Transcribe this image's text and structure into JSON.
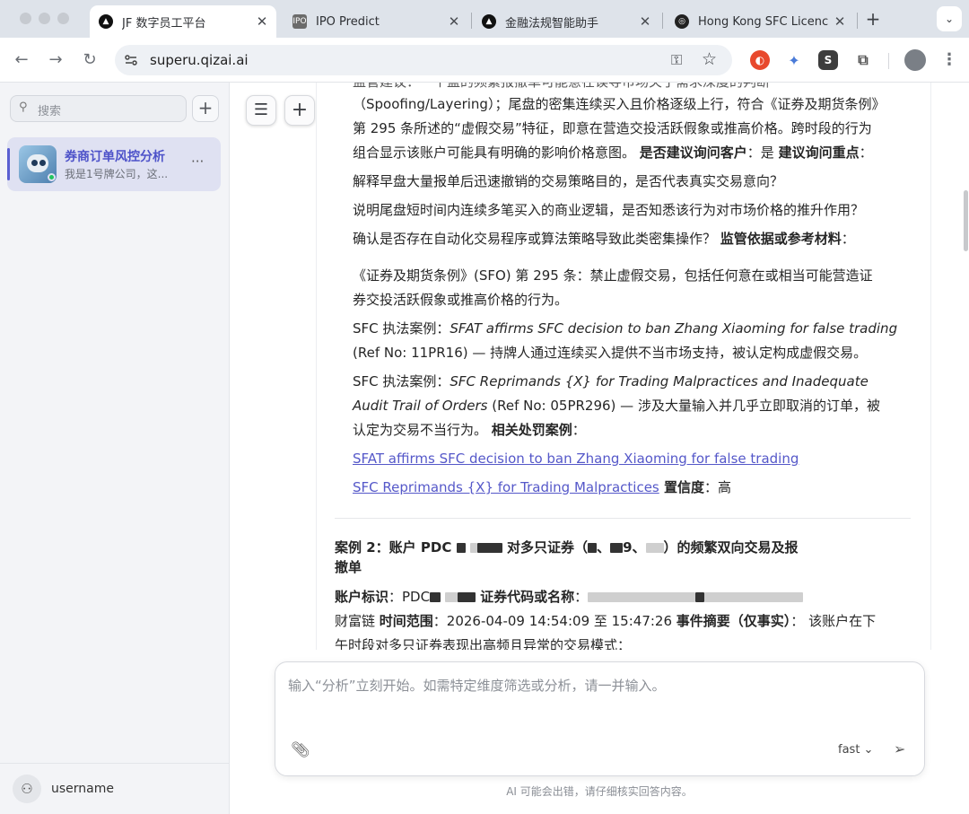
{
  "browser": {
    "tabs": [
      {
        "title": "JF 数字员工平台",
        "active": true
      },
      {
        "title": "IPO Predict",
        "active": false
      },
      {
        "title": "金融法规智能助手",
        "active": false
      },
      {
        "title": "Hong Kong SFC Licenc",
        "active": false
      }
    ],
    "url": "superu.qizai.ai"
  },
  "sidebar": {
    "search_placeholder": "搜索",
    "conversations": [
      {
        "name": "券商订单风控分析",
        "preview": "我是1号牌公司，这..."
      }
    ],
    "username": "username"
  },
  "main": {
    "lines": {
      "l0": "监管建议：一个盘的频繁报撤单可能意在误导市场关于需求深度的判断",
      "l1": "（Spoofing/Layering）；尾盘的密集连续买入且价格逐级上行，符合《证券及期货条例》",
      "l2": "第 295 条所述的“虚假交易”特征，即意在营造交投活跃假象或推高价格。跨时段的行为",
      "l3a": "组合显示该账户可能具有明确的影响价格意图。 ",
      "l3b": "是否建议询问客户",
      "l3c": "：是 ",
      "l3d": "建议询问重点",
      "l3e": "：",
      "l4": "解释早盘大量报单后迅速撤销的交易策略目的，是否代表真实交易意向？",
      "l5": "说明尾盘短时间内连续多笔买入的商业逻辑，是否知悉该行为对市场价格的推升作用？",
      "l6a": "确认是否存在自动化交易程序或算法策略导致此类密集操作？ ",
      "l6b": "监管依据或参考材料",
      "l6c": "：",
      "l7": "《证券及期货条例》(SFO) 第 295 条：禁止虚假交易，包括任何意在或相当可能营造证",
      "l8": "券交投活跃假象或推高价格的行为。",
      "l9a": "SFC 执法案例：",
      "l9b": "SFAT affirms SFC decision to ban Zhang Xiaoming for false trading",
      "l10": "(Ref No: 11PR16) — 持牌人通过连续买入提供不当市场支持，被认定构成虚假交易。",
      "l11a": "SFC 执法案例：",
      "l11b": "SFC Reprimands {X} for Trading Malpractices and Inadequate",
      "l12a": "Audit Trail of Orders",
      "l12b": " (Ref No: 05PR296) — 涉及大量输入并几乎立即取消的订单，被",
      "l13a": "认定为交易不当行为。 ",
      "l13b": "相关处罚案例",
      "l13c": "：",
      "link1": "SFAT affirms SFC decision to ban Zhang Xiaoming for false trading",
      "link2": "SFC Reprimands {X} for Trading Malpractices",
      "l15a": " 置信度",
      "l15b": "：高"
    },
    "case2": {
      "heading_a": "案例 2：账户 PDC",
      "heading_b": " 对多只证券（",
      "heading_c": "、",
      "heading_d": "9、",
      "heading_e": "）的频繁双向交易及报",
      "heading_f": "撤单",
      "acct_label": "账户标识",
      "acct_val": "：PDC",
      "code_label": " 证券代码或名称",
      "code_val": "：",
      "l3a": "财富链 ",
      "time_label": "时间范围",
      "time_val": "：2026-04-09 14:54:09 至 15:47:26 ",
      "summary_label": "事件摘要（仅事实）",
      "summary_val": "： 该账户在下",
      "l4": "午时段对多只证券表现出高频且异常的交易模式："
    }
  },
  "input": {
    "placeholder": "输入“分析”立刻开始。如需特定维度筛选或分析，请一并输入。",
    "mode": "fast ⌄"
  },
  "disclaimer": "AI 可能会出错，请仔细核实回答内容。"
}
